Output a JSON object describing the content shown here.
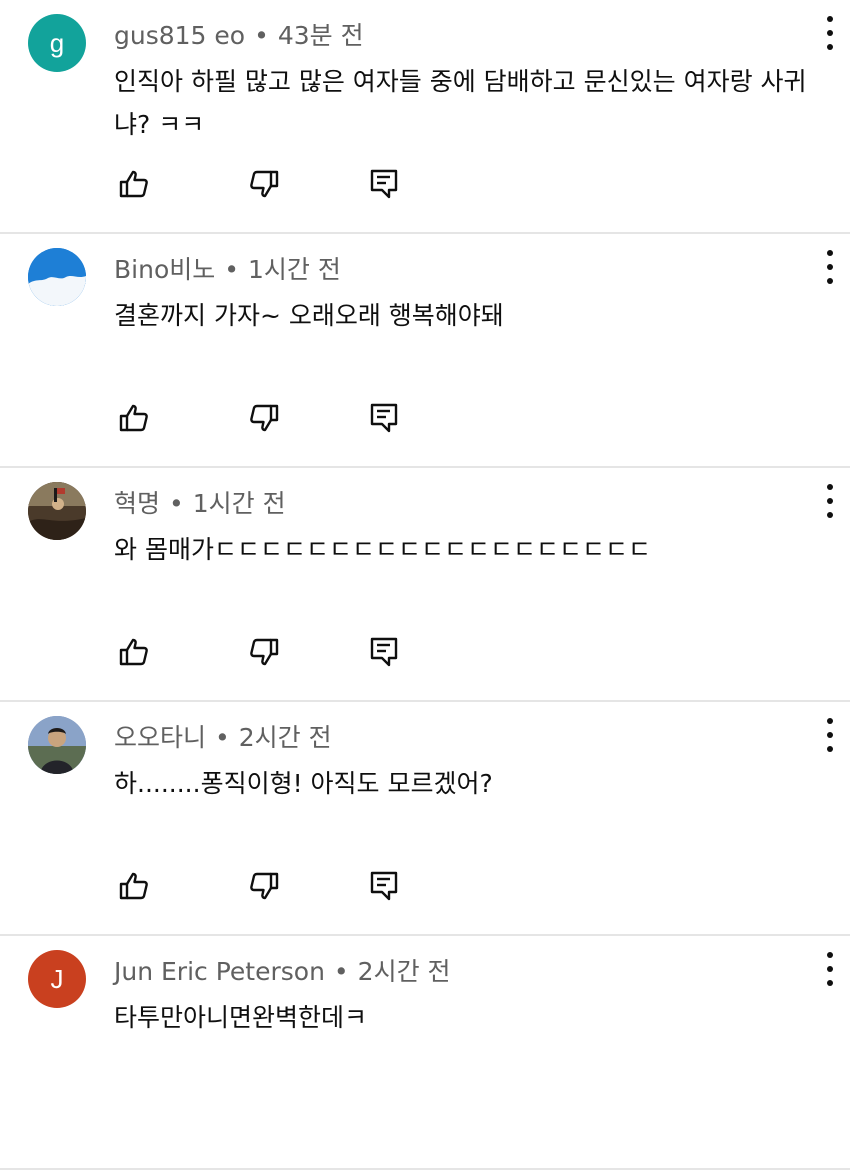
{
  "comments": [
    {
      "avatar_letter": "g",
      "avatar_color": "#12a39b",
      "author": "gus815 eo",
      "time": "43분 전",
      "text": "인직아 하필 많고 많은 여자들 중에 담배하고 문신있는 여자랑 사귀냐? ㅋㅋ"
    },
    {
      "avatar_letter": "",
      "avatar_color": "#1e7fd6",
      "author": "Bino비노",
      "time": "1시간 전",
      "text": "결혼까지 가자~ 오래오래 행복해야돼"
    },
    {
      "avatar_letter": "",
      "avatar_color": "#5a4632",
      "author": "혁명",
      "time": "1시간 전",
      "text": "와 몸매가ㄷㄷㄷㄷㄷㄷㄷㄷㄷㄷㄷㄷㄷㄷㄷㄷㄷㄷㄷ"
    },
    {
      "avatar_letter": "",
      "avatar_color": "#6f88b0",
      "author": "오오타니",
      "time": "2시간 전",
      "text": "하........퐁직이형! 아직도 모르겠어?"
    },
    {
      "avatar_letter": "J",
      "avatar_color": "#c9401f",
      "author": "Jun Eric Peterson",
      "time": "2시간 전",
      "text": "타투만아니면완벽한데ㅋ"
    }
  ],
  "separator": "•",
  "icons": {
    "like": "thumb-up-icon",
    "dislike": "thumb-down-icon",
    "reply": "reply-icon",
    "menu": "more-vert-icon"
  }
}
